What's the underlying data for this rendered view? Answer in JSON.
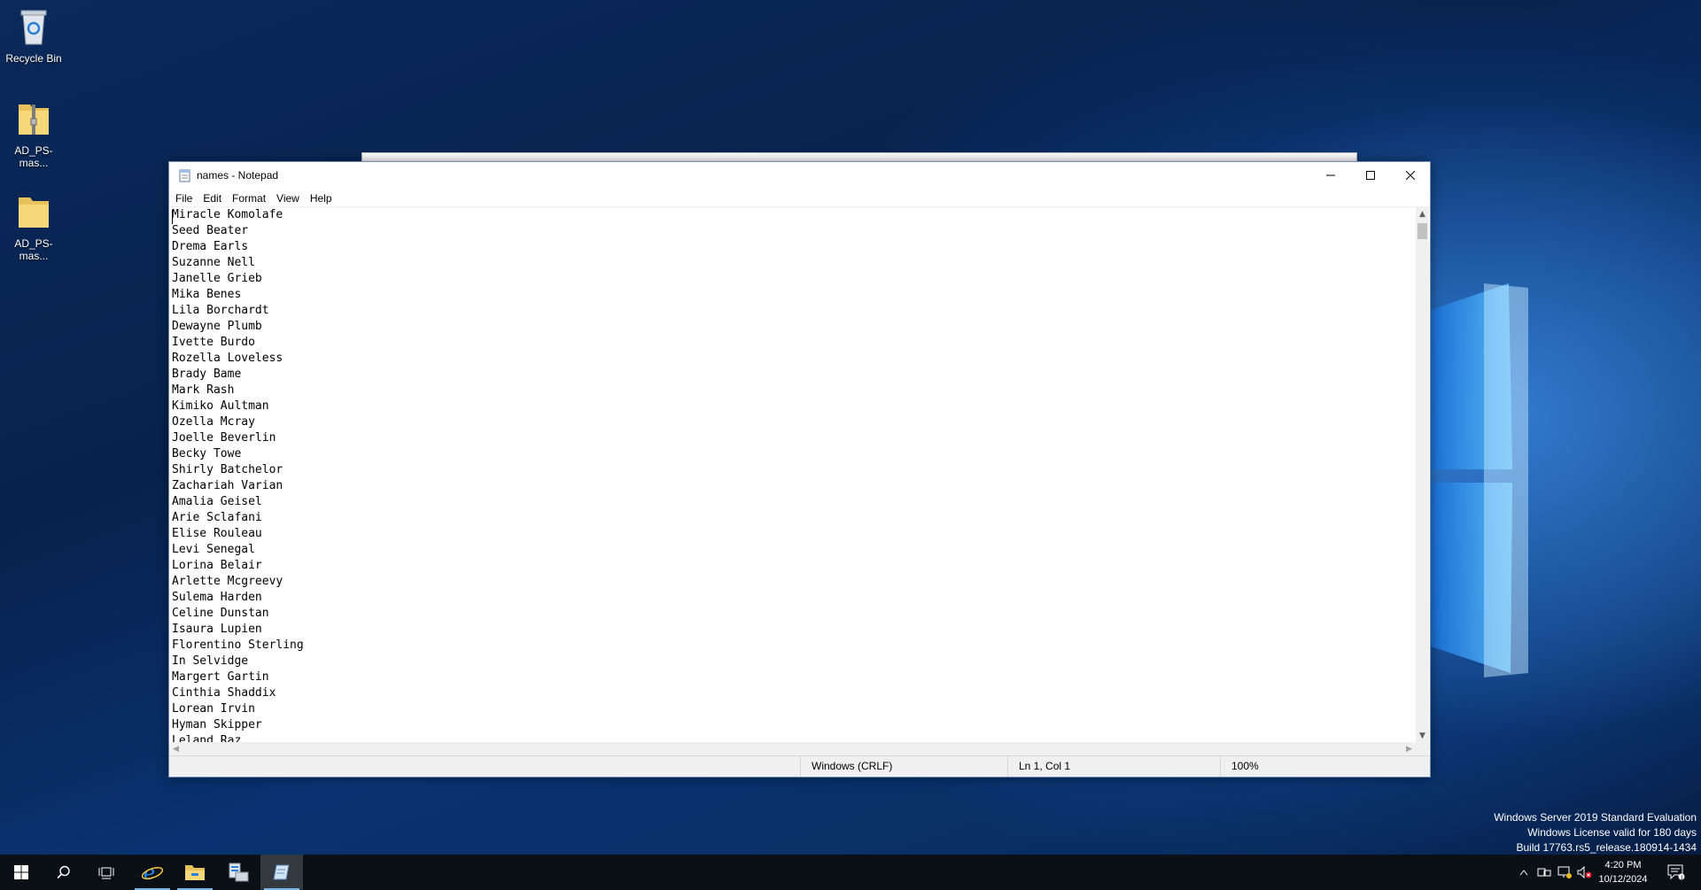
{
  "desktop": {
    "icons": [
      {
        "label": "Recycle Bin"
      },
      {
        "label": "AD_PS-mas..."
      },
      {
        "label": "AD_PS-mas..."
      }
    ],
    "watermark": {
      "line1": "Windows Server 2019 Standard Evaluation",
      "line2": "Windows License valid for 180 days",
      "line3": "Build 17763.rs5_release.180914-1434"
    }
  },
  "notepad": {
    "title": "names - Notepad",
    "menu": [
      "File",
      "Edit",
      "Format",
      "View",
      "Help"
    ],
    "lines": [
      "Miracle Komolafe",
      "Seed Beater",
      "Drema Earls",
      "Suzanne Nell",
      "Janelle Grieb",
      "Mika Benes",
      "Lila Borchardt",
      "Dewayne Plumb",
      "Ivette Burdo",
      "Rozella Loveless",
      "Brady Bame",
      "Mark Rash",
      "Kimiko Aultman",
      "Ozella Mcray",
      "Joelle Beverlin",
      "Becky Towe",
      "Shirly Batchelor",
      "Zachariah Varian",
      "Amalia Geisel",
      "Arie Sclafani",
      "Elise Rouleau",
      "Levi Senegal",
      "Lorina Belair",
      "Arlette Mcgreevy",
      "Sulema Harden",
      "Celine Dunstan",
      "Isaura Lupien",
      "Florentino Sterling",
      "In Selvidge",
      "Margert Gartin",
      "Cinthia Shaddix",
      "Lorean Irvin",
      "Hyman Skipper",
      "Leland Raz"
    ],
    "status": {
      "line_ending": "Windows (CRLF)",
      "position": "Ln 1, Col 1",
      "zoom": "100%"
    }
  },
  "taskbar": {
    "clock_time": "4:20 PM",
    "clock_date": "10/12/2024"
  }
}
